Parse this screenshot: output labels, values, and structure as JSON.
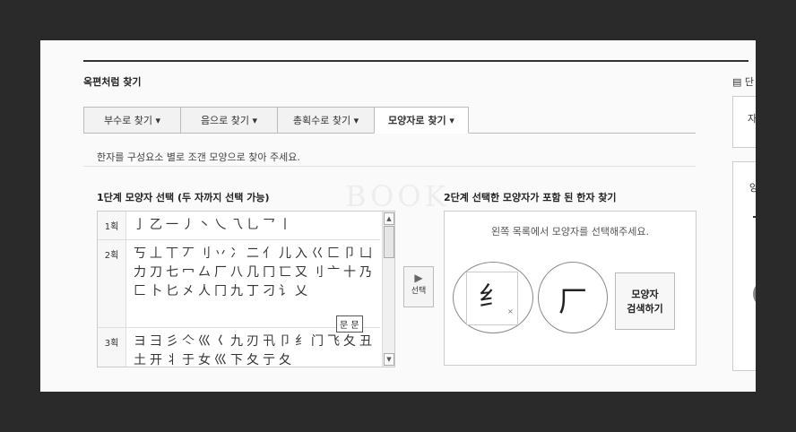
{
  "page_title": "옥편처럼 찾기",
  "tabs": [
    {
      "label": "부수로 찾기 ▾",
      "active": false
    },
    {
      "label": "음으로 찾기 ▾",
      "active": false
    },
    {
      "label": "총획수로 찾기 ▾",
      "active": false
    },
    {
      "label": "모양자로 찾기 ▾",
      "active": true
    }
  ],
  "description": "한자를 구성요소 별로 조갠 모양으로 찾아 주세요.",
  "step1_title": "1단계 모양자 선택 (두 자까지 선택 가능)",
  "step2_title": "2단계 선택한 모양자가 포함 된 한자 찾기",
  "stroke_rows": [
    {
      "label": "1획",
      "chars": "亅乙一丿丶乀乁乚乛丨"
    },
    {
      "label": "2획",
      "chars": "丂丄丅丆刂丷冫二亻儿入巜匚卩凵力刀七冖厶厂八几冂匸又刂亠十乃匚卜匕㐅人冂九丁刁讠乂"
    },
    {
      "label": "3획",
      "chars": "ヨ彐彡亽巛𡿨九刃卂卩纟门飞夂丑土开丬于女巛下夂亍夂"
    }
  ],
  "selected_char_tooltip": "문 문",
  "select_button_label": "선택",
  "step2_instruction": "왼쪽 목록에서 모양자를 선택해주세요.",
  "selected_shapes": [
    "纟",
    "厂"
  ],
  "remove_label": "×",
  "search_button": {
    "line1": "모양자",
    "line2": "검색하기"
  },
  "side_panel": {
    "label": "단",
    "box1_text": "자",
    "box2_text": "양"
  },
  "watermark": "BOOK",
  "icons": {
    "scroll_up": "▲",
    "scroll_down": "▼",
    "select_arrow": "▶",
    "side_list": "▤"
  }
}
